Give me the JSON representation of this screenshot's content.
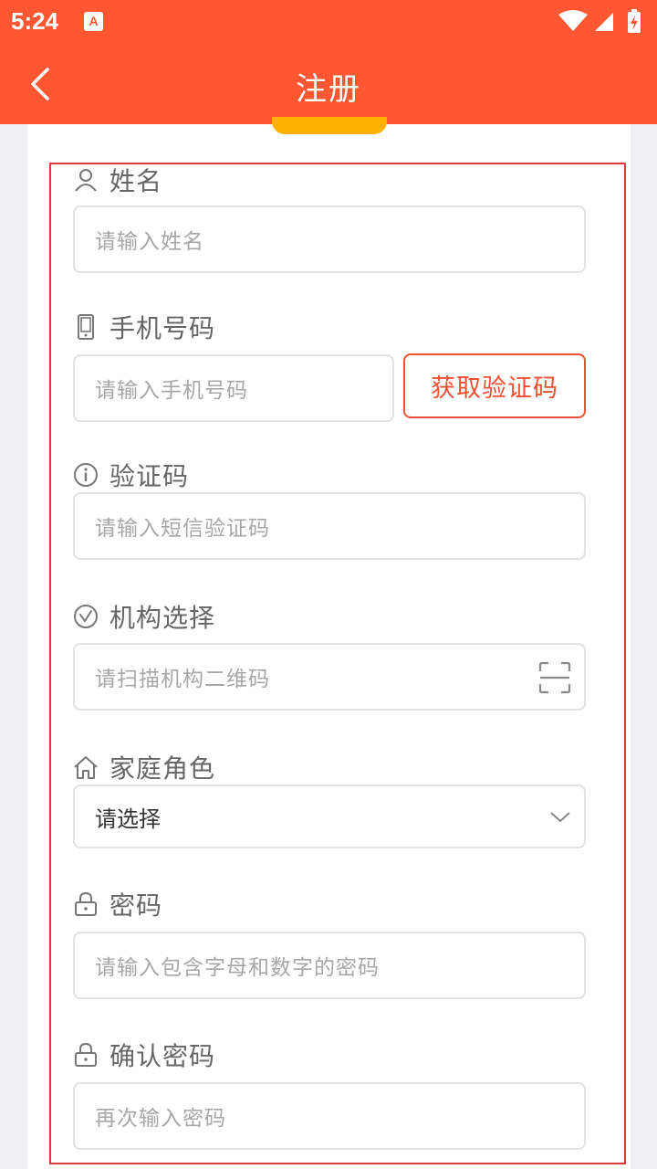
{
  "status_bar": {
    "time": "5:24",
    "notif_letter": "A"
  },
  "header": {
    "title": "注册"
  },
  "form": {
    "name": {
      "label": "姓名",
      "placeholder": "请输入姓名"
    },
    "phone": {
      "label": "手机号码",
      "placeholder": "请输入手机号码",
      "code_button": "获取验证码"
    },
    "code": {
      "label": "验证码",
      "placeholder": "请输入短信验证码"
    },
    "org": {
      "label": "机构选择",
      "placeholder": "请扫描机构二维码"
    },
    "role": {
      "label": "家庭角色",
      "selected": "请选择"
    },
    "password": {
      "label": "密码",
      "placeholder": "请输入包含字母和数字的密码"
    },
    "confirm": {
      "label": "确认密码",
      "placeholder": "再次输入密码"
    }
  },
  "colors": {
    "brand": "#ff5732",
    "accent_tab": "#ffb300",
    "button_red": "#f05133",
    "frame": "#e03a3a"
  },
  "icons": [
    "user-icon",
    "phone-icon",
    "info-icon",
    "org-icon",
    "home-icon",
    "lock-icon",
    "scan-icon",
    "chevron-down-icon",
    "back-arrow-icon",
    "wifi-icon",
    "signal-icon",
    "battery-icon"
  ]
}
